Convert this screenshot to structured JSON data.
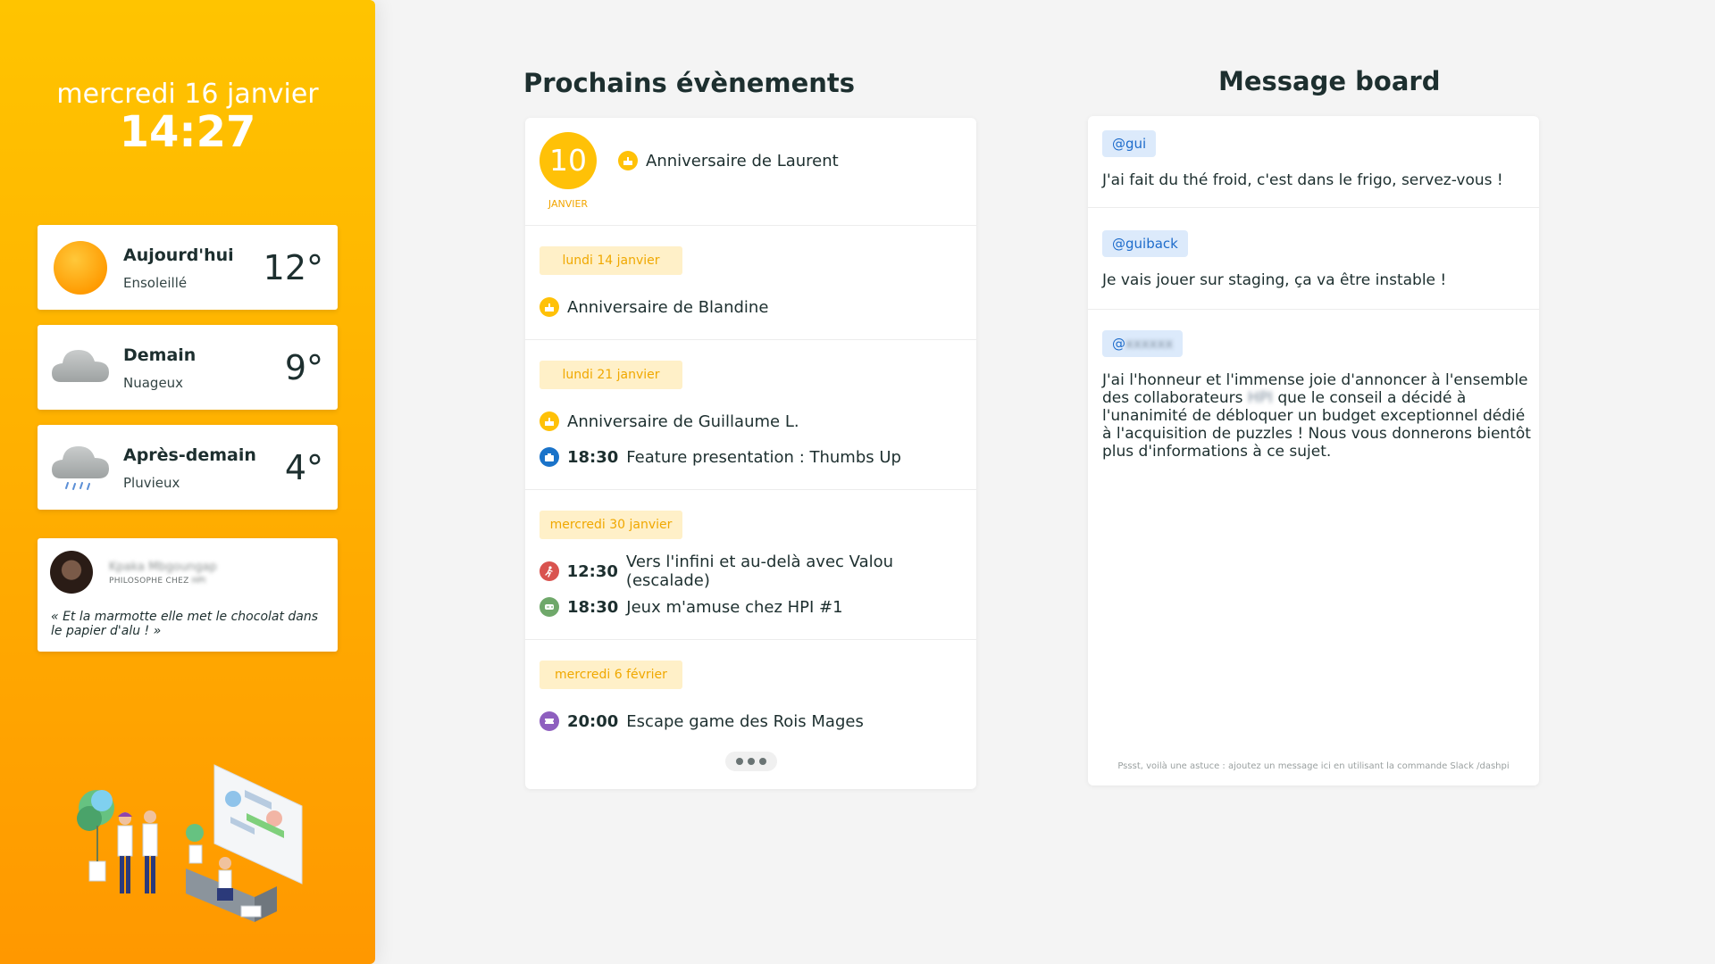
{
  "sidebar": {
    "date": "mercredi 16 janvier",
    "time": "14:27",
    "weather": [
      {
        "day": "Aujourd'hui",
        "desc": "Ensoleillé",
        "temp": "12°",
        "icon": "sun-icon"
      },
      {
        "day": "Demain",
        "desc": "Nuageux",
        "temp": "9°",
        "icon": "cloud-icon"
      },
      {
        "day": "Après-demain",
        "desc": "Pluvieux",
        "temp": "4°",
        "icon": "rain-cloud-icon"
      }
    ],
    "quote": {
      "name": "Kpaka Mbgoungap",
      "role_prefix": "PHILOSOPHE CHEZ",
      "role_company": "HPI",
      "text": "« Et la marmotte elle met le chocolat dans le papier d'alu ! »"
    }
  },
  "events": {
    "title": "Prochains évènements",
    "featured": {
      "day": "10",
      "month": "JANVIER",
      "title": "Anniversaire de Laurent",
      "icon": "cake-icon"
    },
    "groups": [
      {
        "date": "lundi 14 janvier",
        "items": [
          {
            "time": "",
            "title": "Anniversaire de Blandine",
            "icon": "cake-icon"
          }
        ]
      },
      {
        "date": "lundi 21 janvier",
        "items": [
          {
            "time": "",
            "title": "Anniversaire de Guillaume L.",
            "icon": "cake-icon"
          },
          {
            "time": "18:30",
            "title": "Feature presentation : Thumbs Up",
            "icon": "briefcase-icon"
          }
        ]
      },
      {
        "date": "mercredi 30 janvier",
        "items": [
          {
            "time": "12:30",
            "title": "Vers l'infini et au-delà avec Valou (escalade)",
            "icon": "climbing-icon"
          },
          {
            "time": "18:30",
            "title": "Jeux m'amuse chez HPI #1",
            "icon": "gamepad-icon"
          }
        ]
      },
      {
        "date": "mercredi 6 février",
        "items": [
          {
            "time": "20:00",
            "title": "Escape game des Rois Mages",
            "icon": "ticket-icon"
          }
        ]
      }
    ],
    "colors": {
      "cake": "#ffc107",
      "briefcase": "#1a73c9",
      "climbing": "#d9534f",
      "gamepad": "#6fa86a",
      "ticket": "#8e5fbf"
    }
  },
  "messages": {
    "title": "Message board",
    "items": [
      {
        "author": "@gui",
        "text": "J'ai fait du thé froid, c'est dans le frigo, servez-vous !"
      },
      {
        "author": "@guiback",
        "text": "Je vais jouer sur staging, ça va être instable !"
      },
      {
        "author_prefix": "@",
        "author_blurred": "xxxxxx",
        "text_before": "J'ai l'honneur et l'immense joie d'annoncer à l'ensemble des collaborateurs ",
        "text_blurred": "HPI",
        "text_after": " que le conseil a décidé à l'unanimité de débloquer un budget exceptionnel dédié à l'acquisition de puzzles ! Nous vous donnerons bientôt plus d'informations à ce sujet."
      }
    ],
    "hint": "Pssst, voilà une astuce : ajoutez un message ici en utilisant la commande Slack /dashpi"
  }
}
